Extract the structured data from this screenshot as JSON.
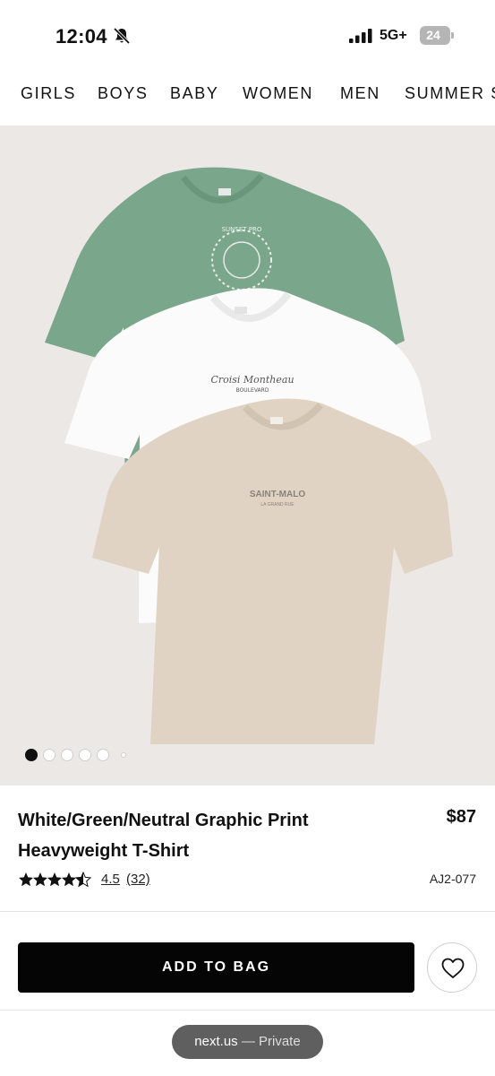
{
  "status_bar": {
    "time": "12:04",
    "network": "5G+",
    "battery": "24",
    "icons": [
      "bell-slash-icon",
      "signal-bars-icon",
      "battery-icon"
    ]
  },
  "nav": {
    "items": [
      "GIRLS",
      "BOYS",
      "BABY",
      "WOMEN",
      "MEN",
      "SUMMER S"
    ]
  },
  "image": {
    "green_shirt_print_ring": "SUNSET PRO",
    "white_shirt_print_script": "Croisi Montheau",
    "white_shirt_print_sub": "BOULEVARD",
    "neutral_shirt_print_main": "SAINT-MALO",
    "neutral_shirt_print_sub": "LA GRAND RUE",
    "colors": {
      "background": "#ebe8e5",
      "green": "#7aa68c",
      "white": "#fbfbfb",
      "neutral": "#e0d3c3"
    },
    "carousel": {
      "count": 6,
      "active_index": 0
    }
  },
  "product": {
    "title": "White/Green/Neutral Graphic Print Heavyweight T-Shirt",
    "price": "$87",
    "rating_value": "4.5",
    "rating_count": "(32)",
    "stars": 4.5,
    "sku": "AJ2-077"
  },
  "actions": {
    "add_to_bag": "ADD TO BAG",
    "wishlist_icon": "heart-icon"
  },
  "browser": {
    "domain": "next.us",
    "mode": "— Private"
  }
}
